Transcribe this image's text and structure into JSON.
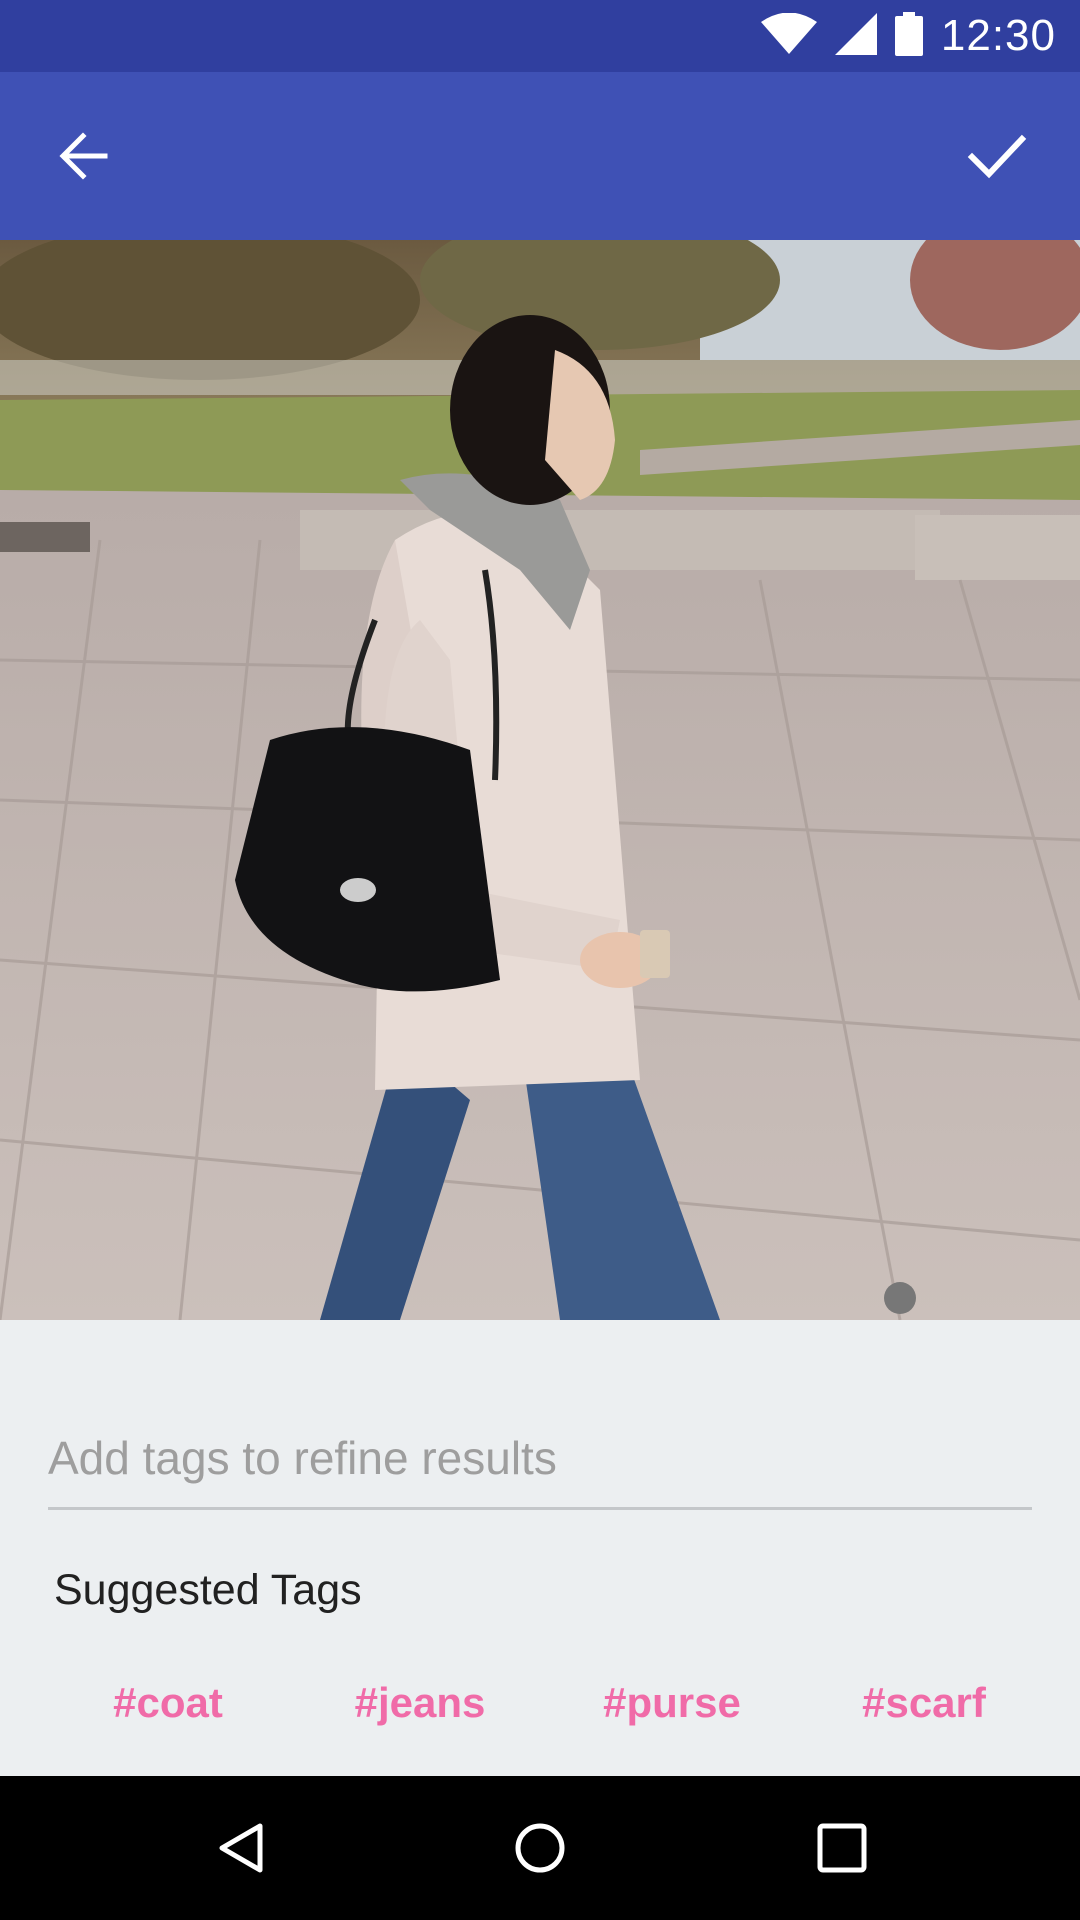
{
  "status_bar": {
    "time": "12:30",
    "icons": [
      "wifi-icon",
      "cellular-signal-icon",
      "battery-icon"
    ]
  },
  "app_bar": {
    "back_icon": "arrow-left-icon",
    "confirm_icon": "checkmark-icon",
    "color": "#3f51b5"
  },
  "photo": {
    "subject": "woman-walking-with-black-purse"
  },
  "tag_input": {
    "value": "",
    "placeholder": "Add tags to refine results"
  },
  "suggested": {
    "title": "Suggested Tags",
    "tags": [
      "#coat",
      "#jeans",
      "#purse",
      "#scarf"
    ],
    "tag_color": "#f06ba8"
  },
  "nav_bar": {
    "icons": [
      "back-triangle-icon",
      "home-circle-icon",
      "recents-square-icon"
    ]
  },
  "colors": {
    "status_bar": "#303f9f",
    "app_bar": "#3f51b5",
    "background": "#eceff1"
  }
}
